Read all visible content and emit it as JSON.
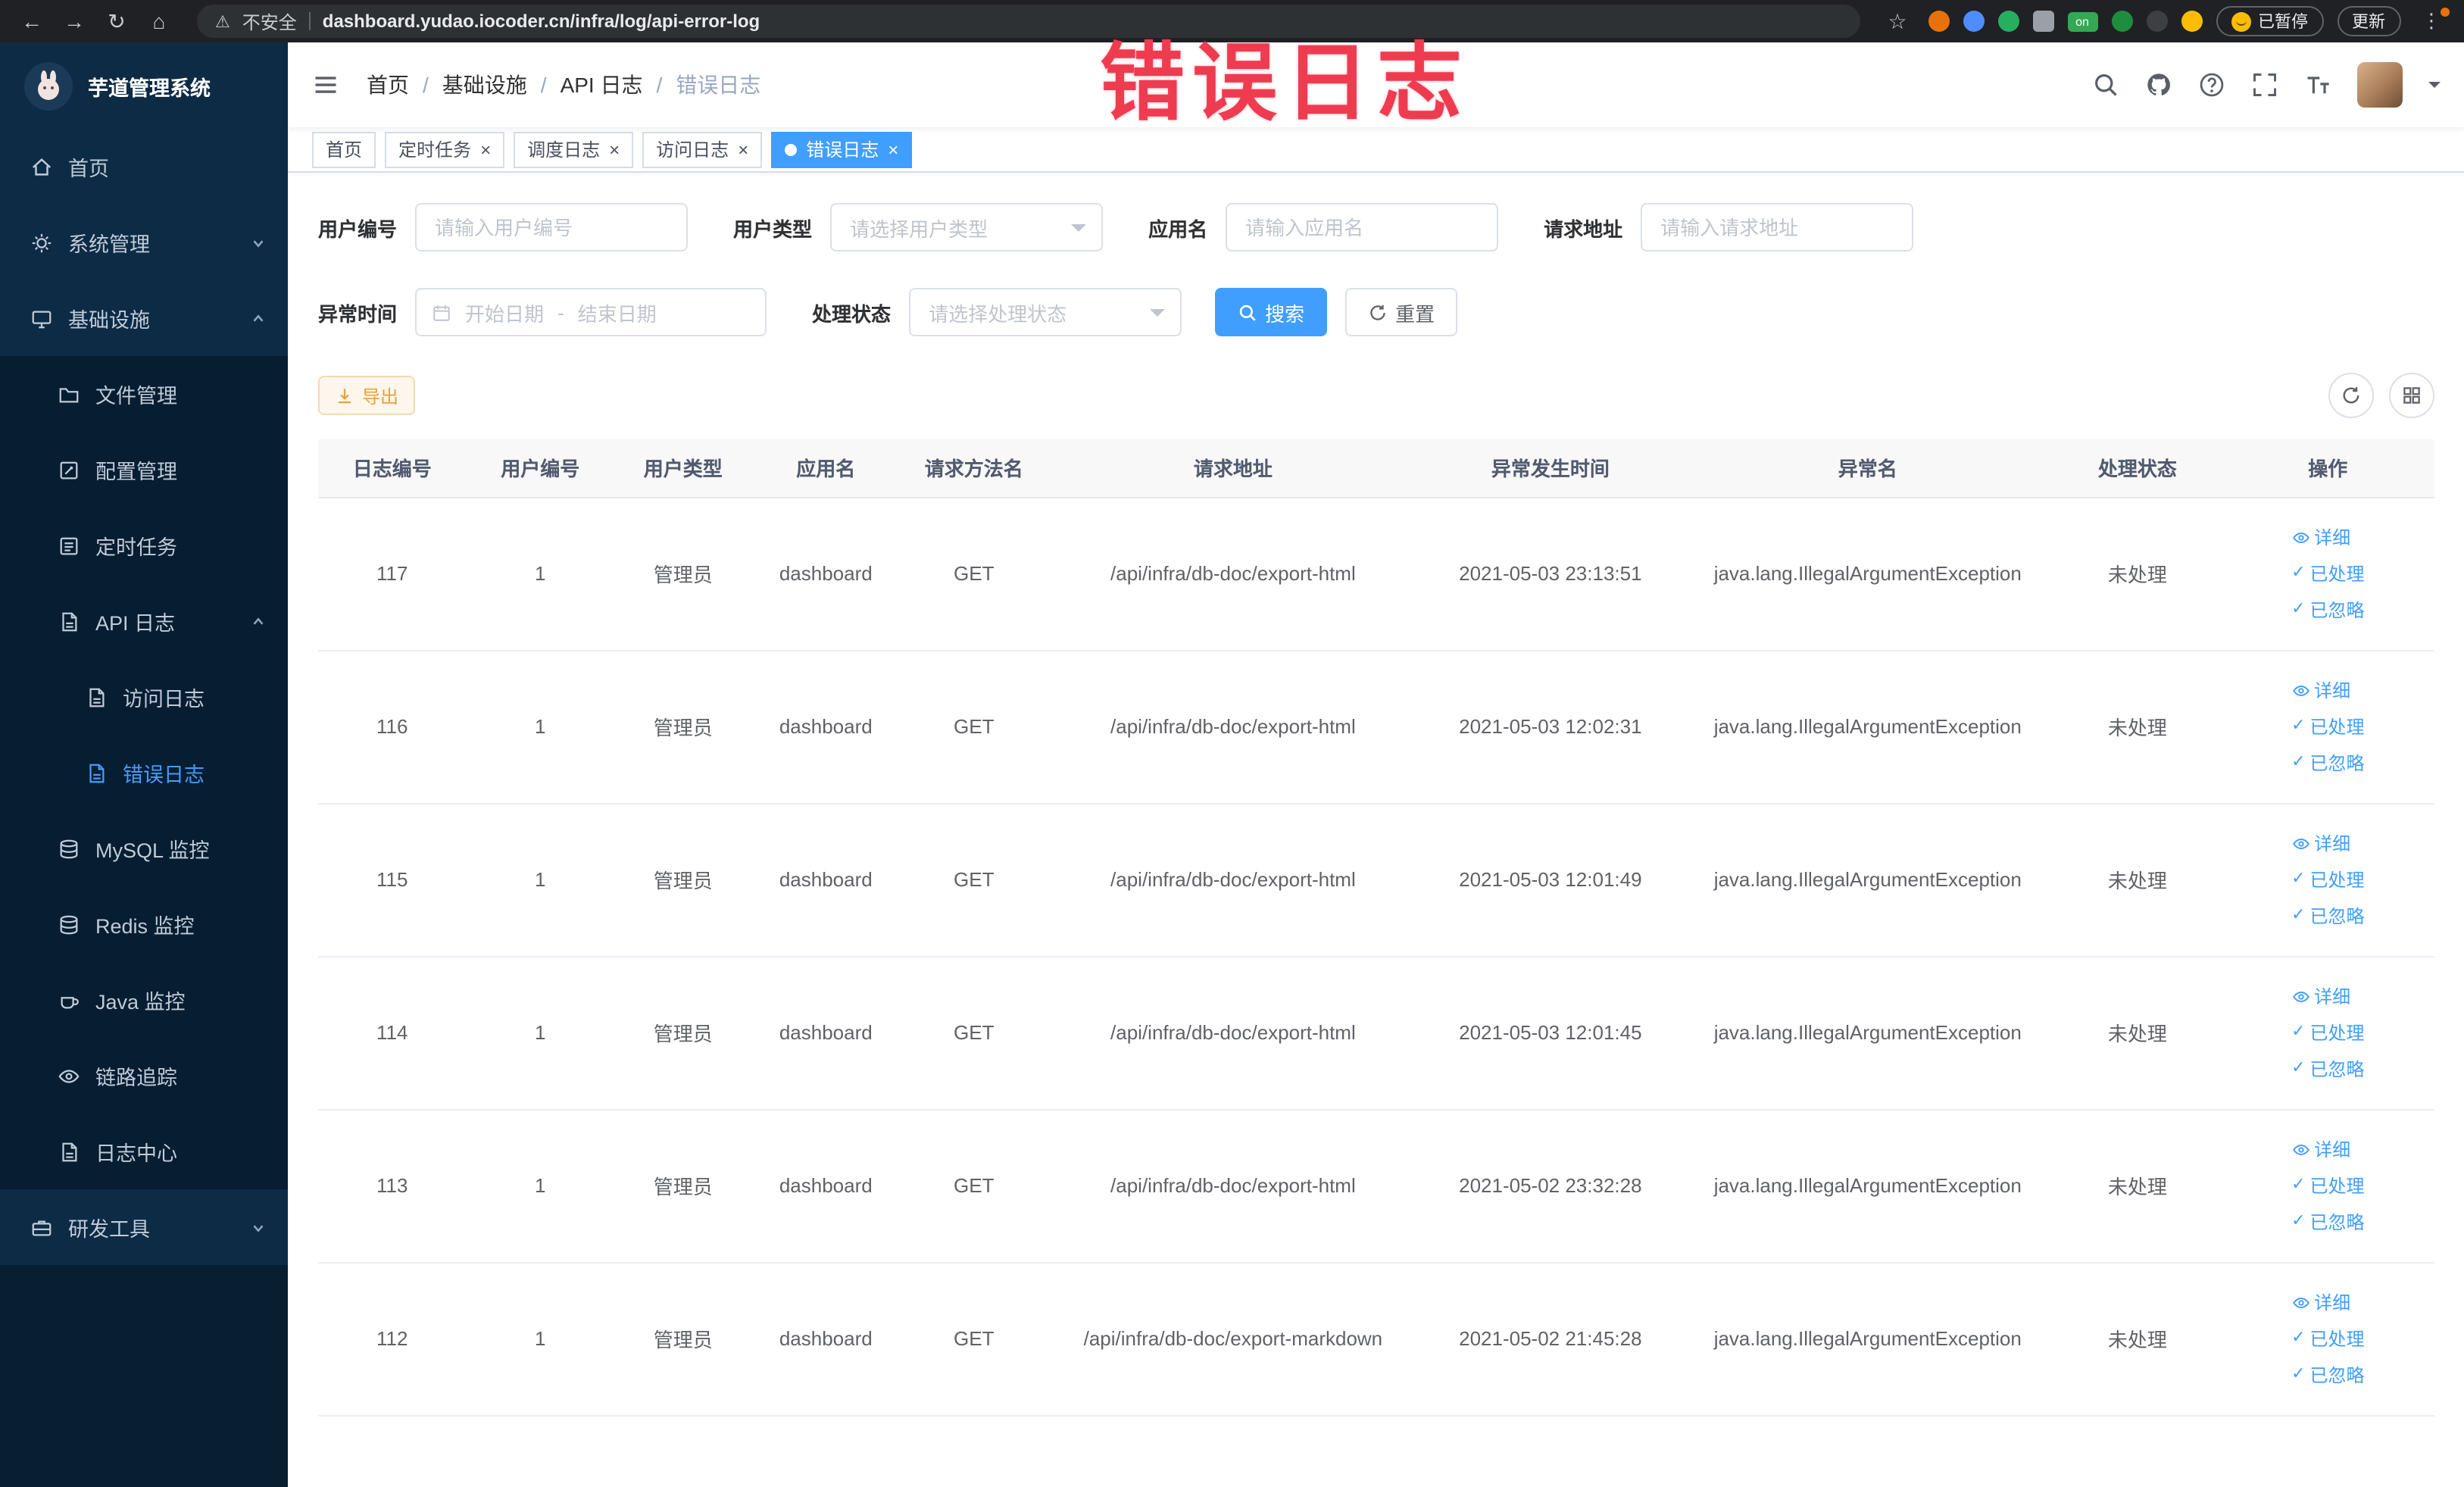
{
  "browser": {
    "back_icon": "←",
    "forward_icon": "→",
    "reload_icon": "↻",
    "home_icon": "⌂",
    "warning_icon": "⚠",
    "security_label": "不安全",
    "url": "dashboard.yudao.iocoder.cn/infra/log/api-error-log",
    "star_icon": "☆",
    "on_badge": "on",
    "paused_label": "已暂停",
    "update_label": "更新",
    "menu_icon": "⋮"
  },
  "annotation": {
    "text": "错误日志"
  },
  "sidebar": {
    "app_title": "芋道管理系统",
    "menu": [
      {
        "label": "首页"
      },
      {
        "label": "系统管理"
      },
      {
        "label": "基础设施"
      },
      {
        "label": "文件管理"
      },
      {
        "label": "配置管理"
      },
      {
        "label": "定时任务"
      },
      {
        "label": "API 日志"
      },
      {
        "label": "访问日志"
      },
      {
        "label": "错误日志"
      },
      {
        "label": "MySQL 监控"
      },
      {
        "label": "Redis 监控"
      },
      {
        "label": "Java 监控"
      },
      {
        "label": "链路追踪"
      },
      {
        "label": "日志中心"
      },
      {
        "label": "研发工具"
      }
    ]
  },
  "navbar": {
    "breadcrumb": [
      "首页",
      "基础设施",
      "API 日志",
      "错误日志"
    ],
    "separator": "/"
  },
  "tabs": [
    {
      "label": "首页"
    },
    {
      "label": "定时任务"
    },
    {
      "label": "调度日志"
    },
    {
      "label": "访问日志"
    },
    {
      "label": "错误日志"
    }
  ],
  "ui": {
    "close_icon": "×",
    "check_icon": "✓"
  },
  "filters": {
    "user_id": {
      "label": "用户编号",
      "placeholder": "请输入用户编号"
    },
    "user_type": {
      "label": "用户类型",
      "placeholder": "请选择用户类型"
    },
    "app_name": {
      "label": "应用名",
      "placeholder": "请输入应用名"
    },
    "request_url": {
      "label": "请求地址",
      "placeholder": "请输入请求地址"
    },
    "exception_time": {
      "label": "异常时间",
      "start_placeholder": "开始日期",
      "separator": "-",
      "end_placeholder": "结束日期"
    },
    "process_status": {
      "label": "处理状态",
      "placeholder": "请选择处理状态"
    },
    "search_button": "搜索",
    "reset_button": "重置"
  },
  "toolbar": {
    "export_button": "导出"
  },
  "table": {
    "columns": [
      "日志编号",
      "用户编号",
      "用户类型",
      "应用名",
      "请求方法名",
      "请求地址",
      "异常发生时间",
      "异常名",
      "处理状态",
      "操作"
    ],
    "actions": {
      "detail": "详细",
      "processed": "已处理",
      "ignored": "已忽略"
    },
    "rows": [
      {
        "id": "117",
        "user_id": "1",
        "user_type": "管理员",
        "app": "dashboard",
        "method": "GET",
        "url": "/api/infra/db-doc/export-html",
        "time": "2021-05-03 23:13:51",
        "exception": "java.lang.IllegalArgumentException",
        "status": "未处理"
      },
      {
        "id": "116",
        "user_id": "1",
        "user_type": "管理员",
        "app": "dashboard",
        "method": "GET",
        "url": "/api/infra/db-doc/export-html",
        "time": "2021-05-03 12:02:31",
        "exception": "java.lang.IllegalArgumentException",
        "status": "未处理"
      },
      {
        "id": "115",
        "user_id": "1",
        "user_type": "管理员",
        "app": "dashboard",
        "method": "GET",
        "url": "/api/infra/db-doc/export-html",
        "time": "2021-05-03 12:01:49",
        "exception": "java.lang.IllegalArgumentException",
        "status": "未处理"
      },
      {
        "id": "114",
        "user_id": "1",
        "user_type": "管理员",
        "app": "dashboard",
        "method": "GET",
        "url": "/api/infra/db-doc/export-html",
        "time": "2021-05-03 12:01:45",
        "exception": "java.lang.IllegalArgumentException",
        "status": "未处理"
      },
      {
        "id": "113",
        "user_id": "1",
        "user_type": "管理员",
        "app": "dashboard",
        "method": "GET",
        "url": "/api/infra/db-doc/export-html",
        "time": "2021-05-02 23:32:28",
        "exception": "java.lang.IllegalArgumentException",
        "status": "未处理"
      },
      {
        "id": "112",
        "user_id": "1",
        "user_type": "管理员",
        "app": "dashboard",
        "method": "GET",
        "url": "/api/infra/db-doc/export-markdown",
        "time": "2021-05-02 21:45:28",
        "exception": "java.lang.IllegalArgumentException",
        "status": "未处理"
      }
    ]
  }
}
